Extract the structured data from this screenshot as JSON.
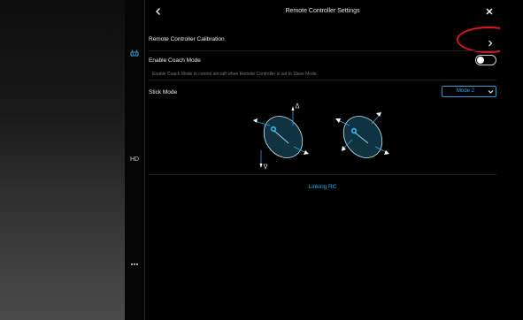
{
  "header": {
    "title": "Remote Controller Settings"
  },
  "sidebar": {
    "hd_label": "HD",
    "more_icon": "ellipsis-icon",
    "rc_icon": "remote-controller-icon"
  },
  "calibration": {
    "label": "Remote Controller Calibration"
  },
  "coach_mode": {
    "label": "Enable Coach Mode",
    "description": "Enable Coach Mode to control aircraft when Remote Controller is set to Slave Mode.",
    "enabled": false
  },
  "stick_mode": {
    "label": "Stick Mode",
    "selected": "Mode 2"
  },
  "linking": {
    "label": "Linking RC"
  },
  "colors": {
    "accent": "#2fb0f0",
    "annotation": "#e0141e"
  }
}
